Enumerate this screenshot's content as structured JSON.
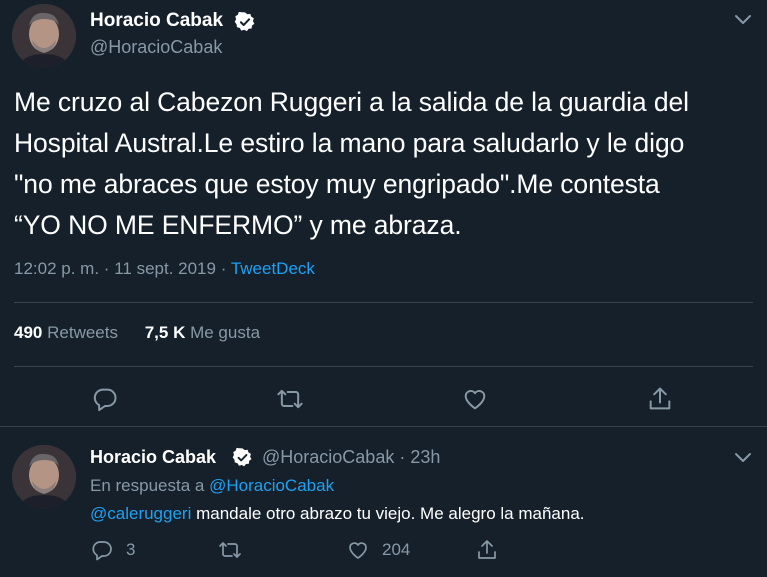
{
  "main_tweet": {
    "author_name": "Horacio Cabak",
    "author_handle": "@HoracioCabak",
    "text": "Me cruzo al Cabezon Ruggeri a la salida de la guardia del\nHospital Austral.Le estiro la mano para saludarlo  y le digo\n\"no me abraces que estoy muy engripado\".Me contesta\n“YO NO ME ENFERMO” y me abraza.",
    "time": "12:02 p. m.",
    "separator": "·",
    "date": "11 sept. 2019",
    "source": "TweetDeck",
    "retweets_count": "490",
    "retweets_label": "Retweets",
    "likes_count": "7,5 K",
    "likes_label": "Me gusta"
  },
  "reply_tweet": {
    "author_name": "Horacio Cabak",
    "author_handle": "@HoracioCabak",
    "separator": "·",
    "age": "23h",
    "in_reply_prefix": "En respuesta a",
    "in_reply_handle": "@HoracioCabak",
    "mention": "@caleruggeri",
    "text": " mandale otro abrazo tu viejo. Me alegro la mañana.",
    "reply_count": "3",
    "like_count": "204"
  },
  "colors": {
    "background": "#15202b",
    "text_primary": "#ffffff",
    "text_secondary": "#8899a6",
    "accent": "#1da1f2",
    "divider": "#38444d"
  },
  "icons": [
    "verified-badge-icon",
    "chevron-down-icon",
    "reply-icon",
    "retweet-icon",
    "like-icon",
    "share-icon"
  ]
}
